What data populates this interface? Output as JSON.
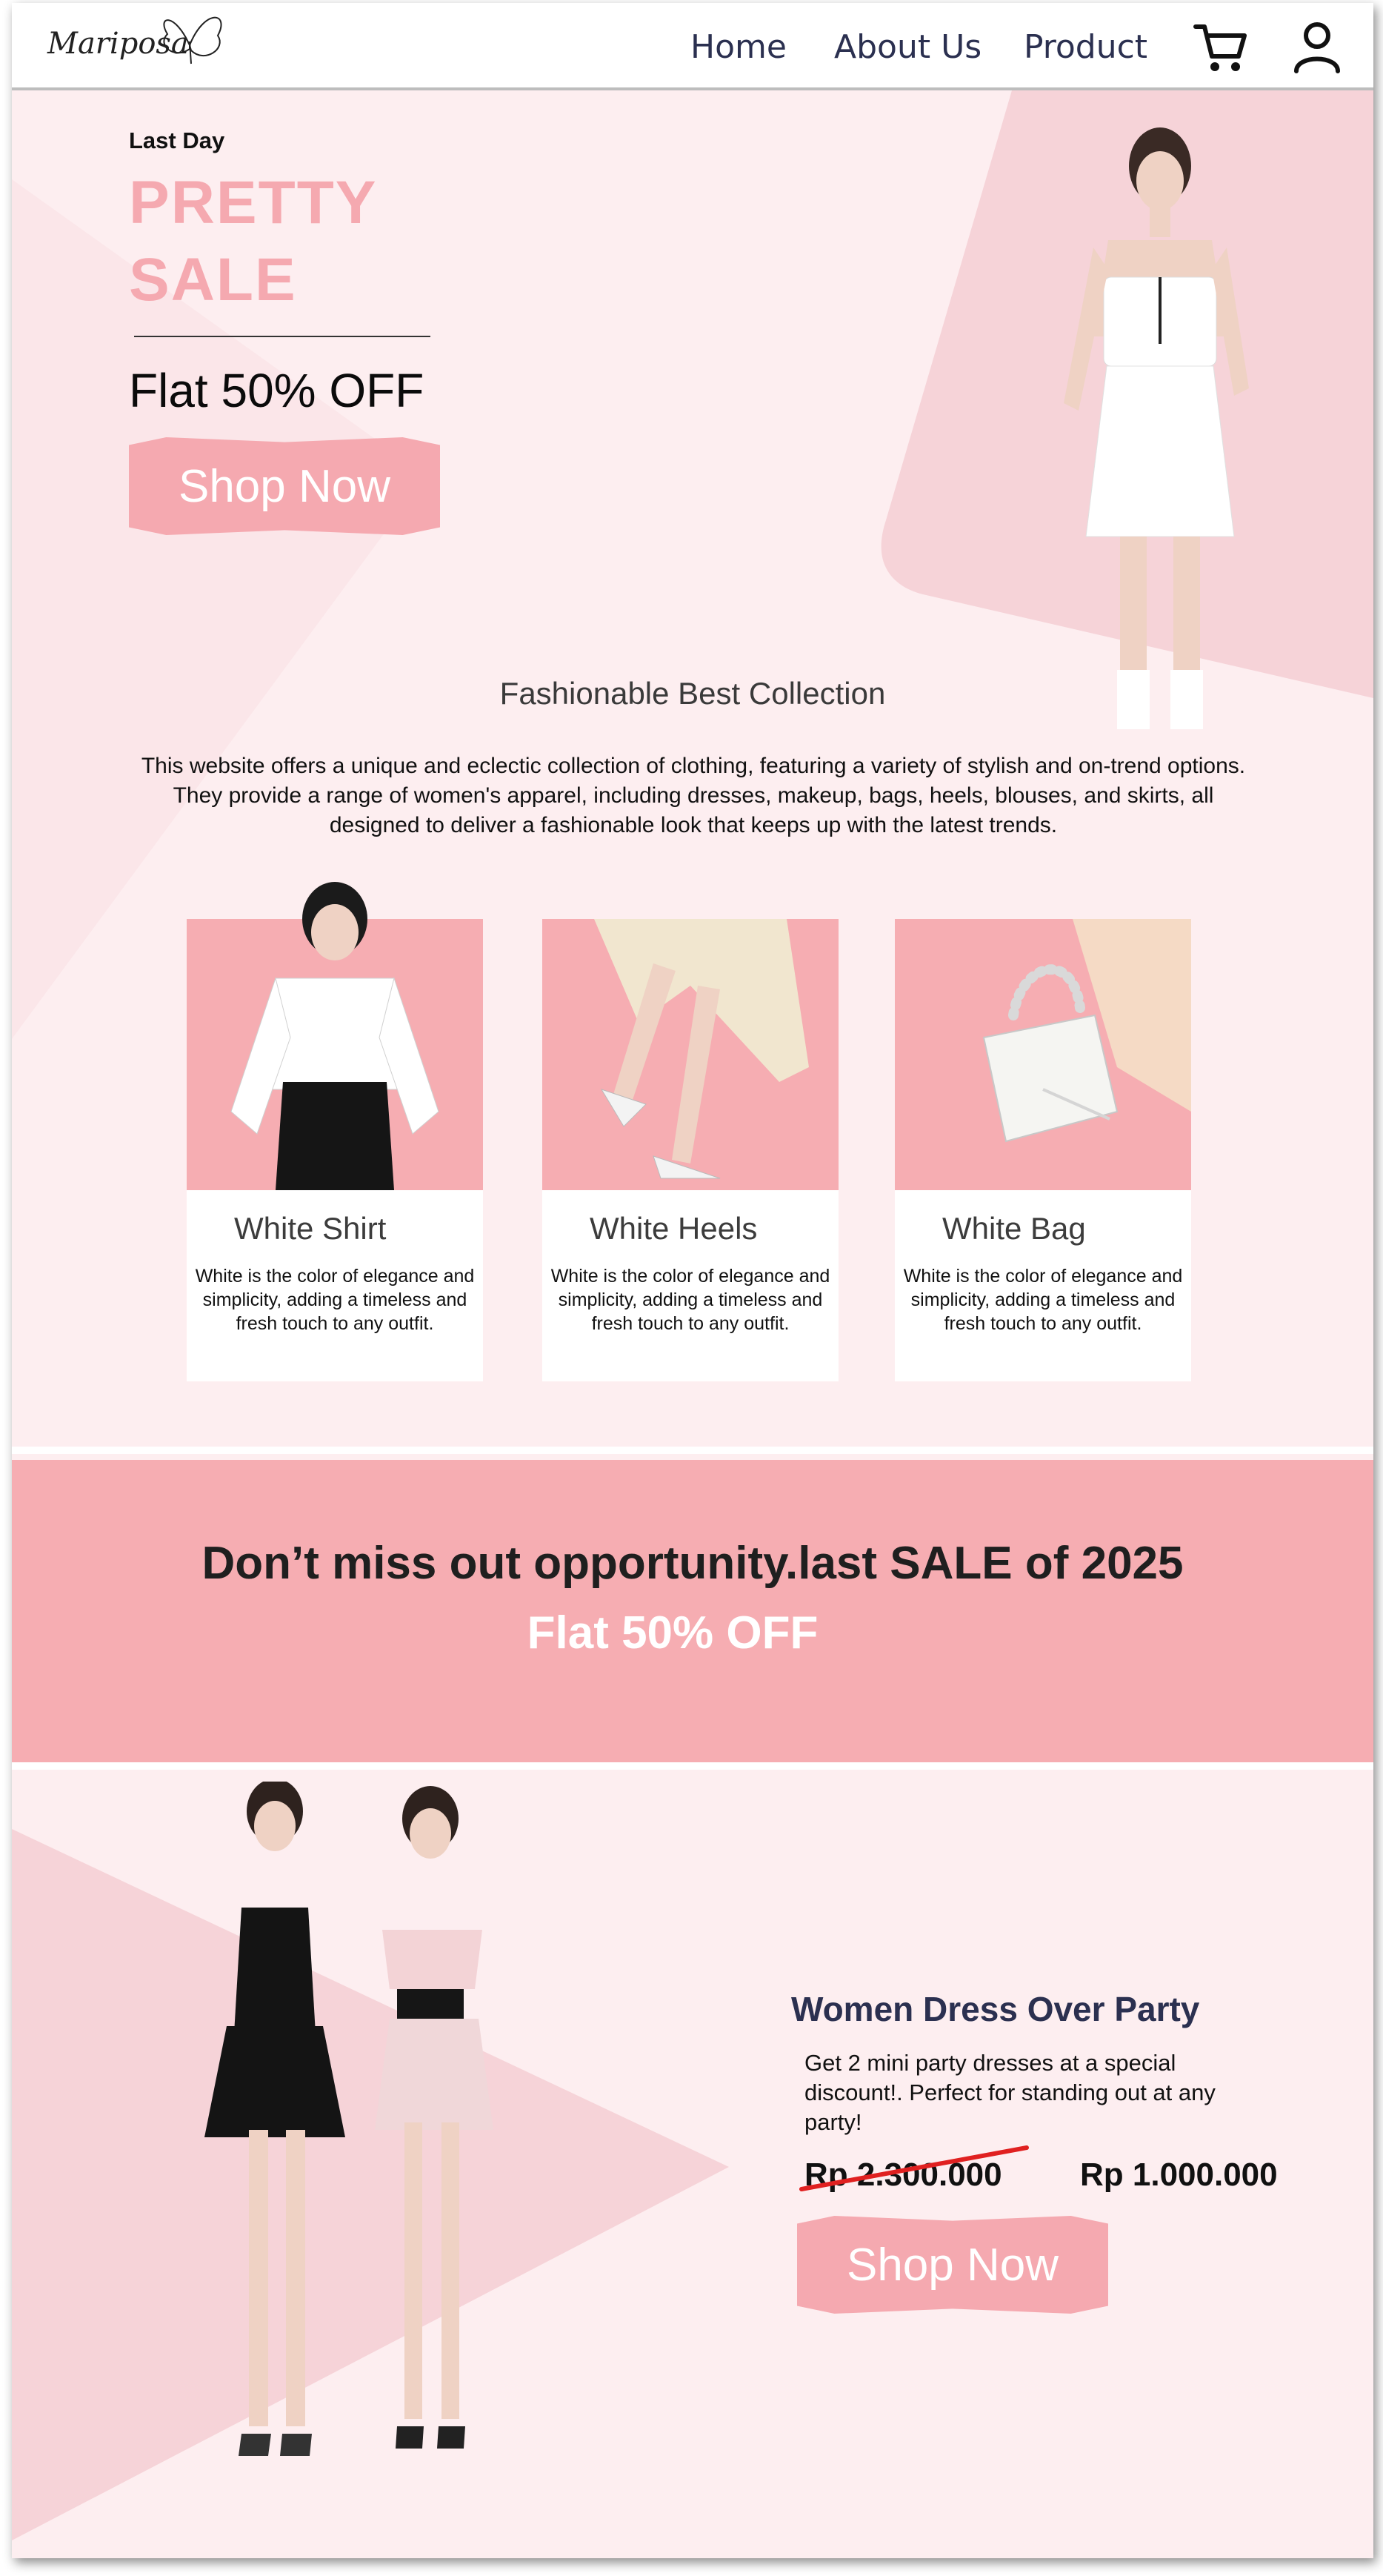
{
  "brand": {
    "logo_text": "Mariposa"
  },
  "nav": {
    "links": [
      "Home",
      "About Us",
      "Product"
    ],
    "icons": [
      "cart-icon",
      "user-icon"
    ]
  },
  "hero": {
    "eyebrow": "Last Day",
    "headline_line1": "PRETTY",
    "headline_line2": "SALE",
    "offer": "Flat 50% OFF",
    "cta": "Shop Now"
  },
  "collection": {
    "title": "Fashionable Best Collection",
    "description": "This website offers a unique and eclectic collection of clothing, featuring a variety of stylish and on-trend options. They provide a range of women's apparel, including dresses, makeup, bags, heels, blouses, and skirts, all designed to deliver a fashionable look that keeps up with the latest trends.",
    "cards": [
      {
        "title": "White Shirt",
        "description": "White is the color of elegance and simplicity, adding a timeless and fresh touch to any outfit."
      },
      {
        "title": "White Heels",
        "description": "White is the color of elegance and simplicity, adding a timeless and fresh touch to any outfit."
      },
      {
        "title": "White Bag",
        "description": "White is the color of elegance and simplicity, adding a timeless and fresh touch to any outfit."
      }
    ]
  },
  "promo": {
    "title": "Don’t miss out opportunity.last SALE of 2025",
    "subtitle": "Flat 50% OFF"
  },
  "product": {
    "title": "Women Dress Over Party",
    "description": "Get 2 mini party dresses at a special discount!. Perfect for standing out at any party!",
    "old_price": "Rp 2.300.000",
    "new_price": "Rp 1.000.000",
    "cta": "Shop Now"
  },
  "colors": {
    "accent_pink": "#f6adb2",
    "background_pink": "#fdeef0",
    "nav_text": "#2b3050",
    "strike_red": "#e02020"
  }
}
